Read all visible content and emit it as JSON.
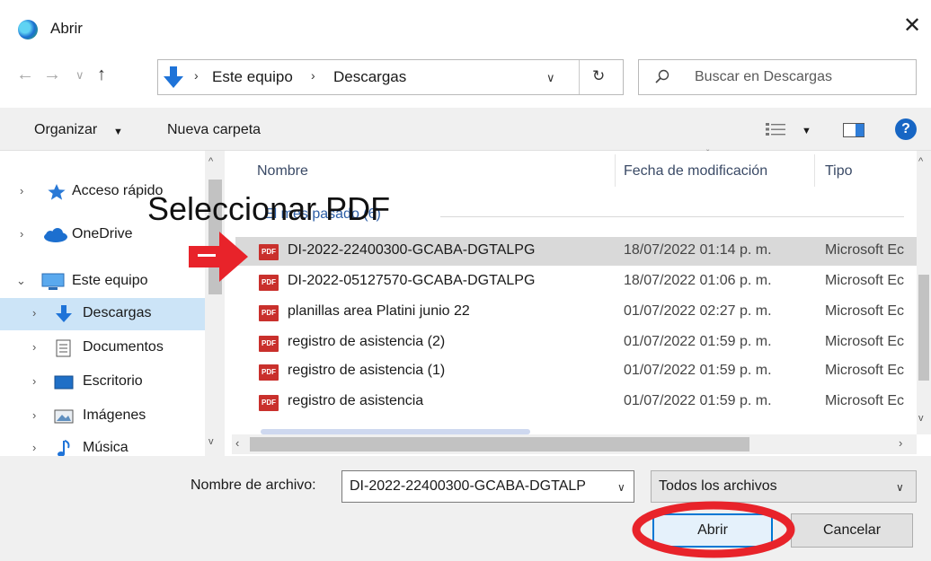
{
  "window": {
    "title": "Abrir"
  },
  "address": {
    "crumbs": [
      "Este equipo",
      "Descargas"
    ],
    "search_placeholder": "Buscar en Descargas"
  },
  "toolbar": {
    "organize_label": "Organizar",
    "new_folder_label": "Nueva carpeta",
    "help_label": "?"
  },
  "nav": {
    "items": [
      {
        "label": "Acceso rápido",
        "icon": "star-icon"
      },
      {
        "label": "OneDrive",
        "icon": "cloud-icon"
      },
      {
        "label": "Este equipo",
        "icon": "computer-icon",
        "expanded": true
      },
      {
        "label": "Descargas",
        "icon": "download-arrow-icon",
        "selected": true
      },
      {
        "label": "Documentos",
        "icon": "document-icon"
      },
      {
        "label": "Escritorio",
        "icon": "desktop-icon"
      },
      {
        "label": "Imágenes",
        "icon": "images-icon"
      },
      {
        "label": "Música",
        "icon": "music-note-icon"
      }
    ]
  },
  "list": {
    "columns": {
      "name": "Nombre",
      "date": "Fecha de modificación",
      "type": "Tipo"
    },
    "group_label": "El mes pasado (6)",
    "pdf_badge": "PDF",
    "files": [
      {
        "name": "DI-2022-22400300-GCABA-DGTALPG",
        "date": "18/07/2022 01:14 p. m.",
        "type": "Microsoft Ec",
        "selected": true
      },
      {
        "name": "DI-2022-05127570-GCABA-DGTALPG",
        "date": "18/07/2022 01:06 p. m.",
        "type": "Microsoft Ec"
      },
      {
        "name": "planillas area Platini junio 22",
        "date": "01/07/2022 02:27 p. m.",
        "type": "Microsoft Ec"
      },
      {
        "name": "registro de asistencia (2)",
        "date": "01/07/2022 01:59 p. m.",
        "type": "Microsoft Ec"
      },
      {
        "name": "registro de asistencia (1)",
        "date": "01/07/2022 01:59 p. m.",
        "type": "Microsoft Ec"
      },
      {
        "name": "registro de asistencia",
        "date": "01/07/2022 01:59 p. m.",
        "type": "Microsoft Ec"
      }
    ]
  },
  "footer": {
    "filename_label": "Nombre de archivo:",
    "filename_value": "DI-2022-22400300-GCABA-DGTALP",
    "filetype_value": "Todos los archivos",
    "open_label": "Abrir",
    "cancel_label": "Cancelar"
  },
  "annotation": {
    "text": "Seleccionar PDF",
    "arrow_color": "#e8232a",
    "ellipse_color": "#e8232a"
  },
  "colors": {
    "selection": "#cce4f7",
    "row_selected": "#d9d9d9",
    "accent": "#0078d4",
    "pdf_red": "#c9302c"
  }
}
